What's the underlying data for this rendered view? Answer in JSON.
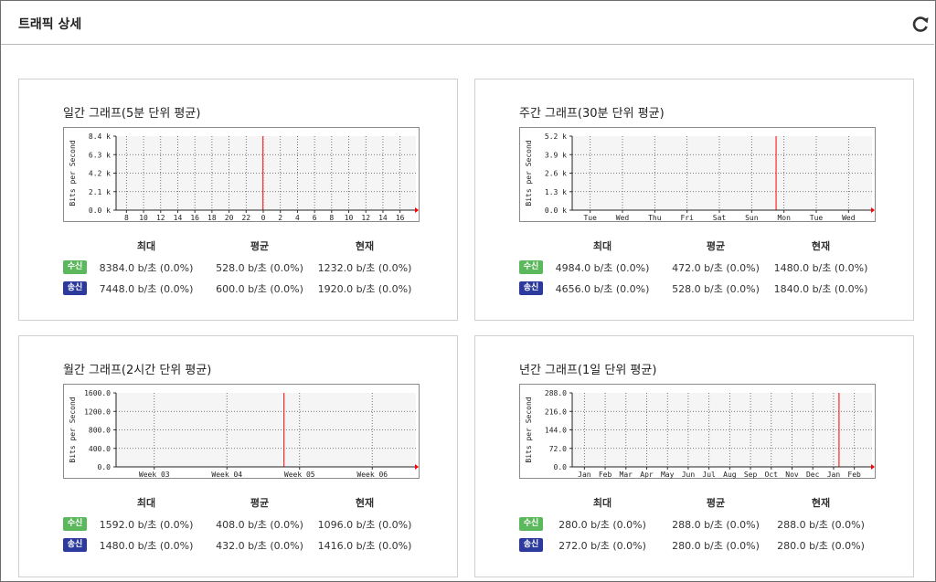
{
  "page": {
    "title": "트래픽 상세"
  },
  "colors": {
    "in": "#00cc00",
    "out": "#0000ff",
    "badge_in": "#5cb85c",
    "badge_out": "#2b3a9c",
    "now_line": "#ff0000",
    "plot_bg": "#f5f5f5"
  },
  "stats_headers": {
    "max": "최대",
    "avg": "평균",
    "cur": "현재"
  },
  "badges": {
    "in": "수신",
    "out": "송신"
  },
  "ylabel": "Bits per Second",
  "panels": [
    {
      "title": "일간 그래프(5분 단위 평균)",
      "y_ticks": [
        "8.4 k",
        "6.3 k",
        "4.2 k",
        "2.1 k",
        "0.0 k"
      ],
      "x_ticks": [
        "8",
        "10",
        "12",
        "14",
        "16",
        "18",
        "20",
        "22",
        "0",
        "2",
        "4",
        "6",
        "8",
        "10",
        "12",
        "14",
        "16"
      ],
      "now_marker": 0.49,
      "stats": {
        "in": [
          "8384.0 b/초 (0.0%)",
          "528.0 b/초 (0.0%)",
          "1232.0 b/초 (0.0%)"
        ],
        "out": [
          "7448.0 b/초 (0.0%)",
          "600.0 b/초 (0.0%)",
          "1920.0 b/초 (0.0%)"
        ]
      }
    },
    {
      "title": "주간 그래프(30분 단위 평균)",
      "y_ticks": [
        "5.2 k",
        "3.9 k",
        "2.6 k",
        "1.3 k",
        "0.0 k"
      ],
      "x_ticks": [
        "Tue",
        "Wed",
        "Thu",
        "Fri",
        "Sat",
        "Sun",
        "Mon",
        "Tue",
        "Wed"
      ],
      "now_marker": 0.68,
      "stats": {
        "in": [
          "4984.0 b/초 (0.0%)",
          "472.0 b/초 (0.0%)",
          "1480.0 b/초 (0.0%)"
        ],
        "out": [
          "4656.0 b/초 (0.0%)",
          "528.0 b/초 (0.0%)",
          "1840.0 b/초 (0.0%)"
        ]
      }
    },
    {
      "title": "월간 그래프(2시간 단위 평균)",
      "y_ticks": [
        "1600.0",
        "1200.0",
        "800.0",
        "400.0",
        "0.0"
      ],
      "x_ticks": [
        "Week 03",
        "Week 04",
        "Week 05",
        "Week 06"
      ],
      "now_marker": 0.56,
      "stats": {
        "in": [
          "1592.0 b/초 (0.0%)",
          "408.0 b/초 (0.0%)",
          "1096.0 b/초 (0.0%)"
        ],
        "out": [
          "1480.0 b/초 (0.0%)",
          "432.0 b/초 (0.0%)",
          "1416.0 b/초 (0.0%)"
        ]
      }
    },
    {
      "title": "년간 그래프(1일 단위 평균)",
      "y_ticks": [
        "288.0",
        "216.0",
        "144.0",
        "72.0",
        "0.0"
      ],
      "x_ticks": [
        "Jan",
        "Feb",
        "Mar",
        "Apr",
        "May",
        "Jun",
        "Jul",
        "Aug",
        "Sep",
        "Oct",
        "Nov",
        "Dec",
        "Jan",
        "Feb"
      ],
      "now_marker": 0.89,
      "stats": {
        "in": [
          "280.0 b/초 (0.0%)",
          "288.0 b/초 (0.0%)",
          "288.0 b/초 (0.0%)"
        ],
        "out": [
          "272.0 b/초 (0.0%)",
          "280.0 b/초 (0.0%)",
          "280.0 b/초 (0.0%)"
        ]
      }
    }
  ]
}
